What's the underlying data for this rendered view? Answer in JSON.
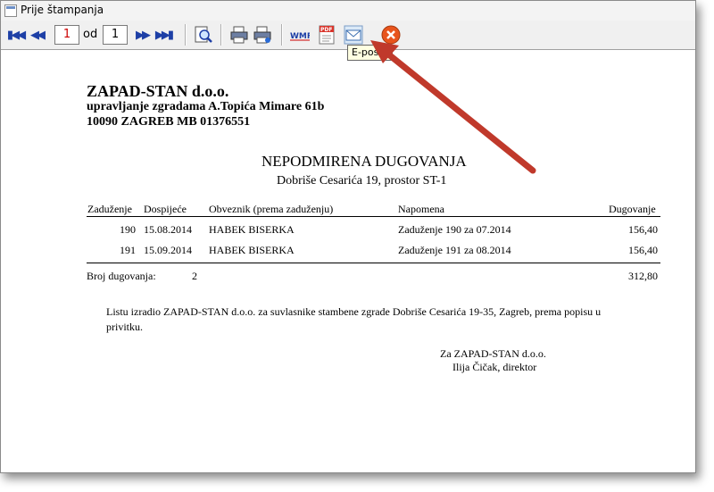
{
  "window": {
    "title": "Prije štampanja"
  },
  "toolbar": {
    "current_page": "1",
    "of_label": "od",
    "total_pages": "1",
    "tooltip": "E-pošta",
    "icons": [
      "first-page",
      "prev-page",
      "next-page",
      "last-page",
      "zoom",
      "print",
      "print-setup",
      "export-wmf",
      "export-pdf",
      "email",
      "close"
    ]
  },
  "document": {
    "company_name": "ZAPAD-STAN d.o.o.",
    "company_line2": "upravljanje zgradama A.Topića Mimare 61b",
    "company_line3": "10090 ZAGREB   MB 01376551",
    "title": "NEPODMIRENA DUGOVANJA",
    "subtitle": "Dobriše Cesarića 19, prostor ST-1",
    "columns": {
      "zaduzenje": "Zaduženje",
      "dospijece": "Dospijeće",
      "obveznik": "Obveznik (prema zaduženju)",
      "napomena": "Napomena",
      "dugovanje": "Dugovanje"
    },
    "rows": [
      {
        "zaduzenje": "190",
        "dospijece": "15.08.2014",
        "obveznik": "HABEK BISERKA",
        "napomena": "Zaduženje 190 za 07.2014",
        "dugovanje": "156,40"
      },
      {
        "zaduzenje": "191",
        "dospijece": "15.09.2014",
        "obveznik": "HABEK BISERKA",
        "napomena": "Zaduženje 191 za 08.2014",
        "dugovanje": "156,40"
      }
    ],
    "count_label": "Broj dugovanja:",
    "count_value": "2",
    "total": "312,80",
    "paragraph": "Listu izradio ZAPAD-STAN d.o.o. za suvlasnike stambene zgrade Dobriše Cesarića 19-35, Zagreb, prema popisu u privitku.",
    "signature_line1": "Za ZAPAD-STAN d.o.o.",
    "signature_line2": "Ilija Čičak, direktor"
  },
  "colors": {
    "annotation_arrow": "#c0392b",
    "nav_blue": "#1d3fa6",
    "close_orange": "#e8541c"
  }
}
